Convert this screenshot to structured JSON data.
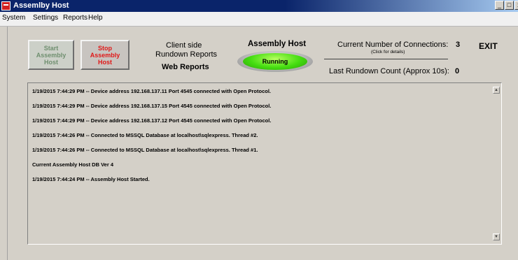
{
  "window": {
    "title": "Assemlby Host",
    "minimize": "_",
    "maximize": "□",
    "close": "x"
  },
  "menu": {
    "items": [
      "System",
      "Settings",
      "Reports",
      "Help"
    ]
  },
  "controls": {
    "start_label": "Start\nAssembly\nHost",
    "stop_label": "Stop\nAssembly\nHost",
    "client_reports_line1": "Client side",
    "client_reports_line2": "Rundown Reports",
    "web_reports": "Web Reports",
    "host_heading": "Assembly Host",
    "status": "Running",
    "connections_label": "Current Number of Connections:",
    "connections_value": "3",
    "click_details": "(Click for details)",
    "rundown_label": "Last Rundown Count (Approx 10s):",
    "rundown_value": "0",
    "exit_label": "EXIT"
  },
  "log": [
    "1/19/2015 7:44:29 PM -- Device address 192.168.137.11 Port 4545 connected with Open Protocol.",
    "1/19/2015 7:44:29 PM -- Device address 192.168.137.15 Port 4545 connected with Open Protocol.",
    "1/19/2015 7:44:29 PM -- Device address 192.168.137.12 Port 4545 connected with Open Protocol.",
    "1/19/2015 7:44:26 PM -- Connected to MSSQL Database at localhost\\sqlexpress. Thread #2.",
    "1/19/2015 7:44:26 PM -- Connected to MSSQL Database at localhost\\sqlexpress. Thread #1.",
    "Current Assembly Host DB Ver 4",
    "1/19/2015 7:44:24 PM -- Assembly Host Started."
  ],
  "colors": {
    "running": "#44dd10",
    "stop_text": "#e01818",
    "title_bar": "#0a246a"
  }
}
